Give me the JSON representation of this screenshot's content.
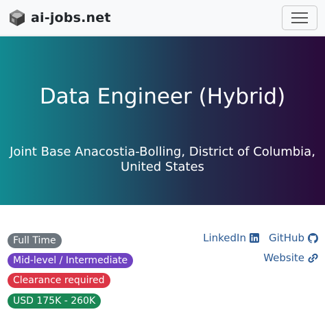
{
  "navbar": {
    "brand_text": "ai-jobs.net",
    "logo_icon": "cube-logo-icon",
    "menu_icon": "hamburger-menu-icon",
    "background": "#f8f9fa"
  },
  "hero": {
    "title": "Data Engineer (Hybrid)",
    "location": "Joint Base Anacostia-Bolling, District of Columbia, United States",
    "gradient_start": "#128a91",
    "gradient_end": "#2a0a3b"
  },
  "badges": [
    {
      "label": "Full Time",
      "color": "#6c757d"
    },
    {
      "label": "Mid-level / Intermediate",
      "color": "#6f42c1"
    },
    {
      "label": "Clearance required",
      "color": "#dc3545"
    },
    {
      "label": "USD 175K - 260K",
      "color": "#198754"
    }
  ],
  "links": {
    "linkedin": {
      "label": "LinkedIn",
      "icon": "linkedin-icon"
    },
    "github": {
      "label": "GitHub",
      "icon": "github-icon"
    },
    "website": {
      "label": "Website",
      "icon": "link-icon"
    },
    "color": "#2b5a93"
  }
}
